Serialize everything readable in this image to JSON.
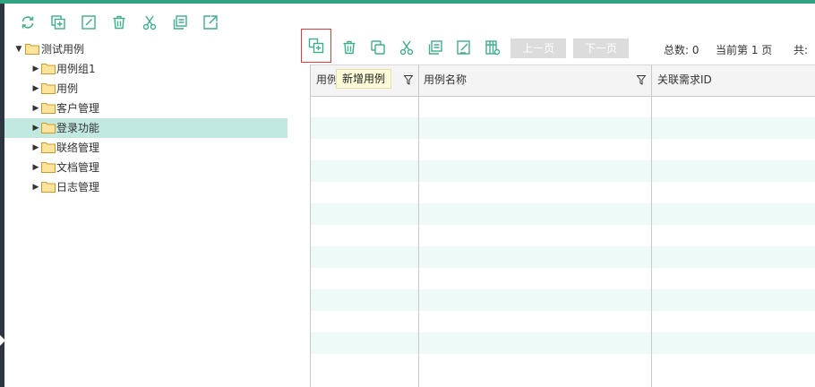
{
  "colors": {
    "accent": "#2fa382",
    "icon_green": "#3fae8e",
    "selected_row": "#c2e9df",
    "stripe": "#eefaf7",
    "folder_fill": "#fde49a",
    "folder_stroke": "#c99a2e",
    "disabled_button": "#dcdcdc",
    "tooltip_bg": "#fdfbd8"
  },
  "left_toolbar": {
    "icons": [
      "refresh-icon",
      "add-copy-icon",
      "edit-icon",
      "trash-icon",
      "scissors-icon",
      "paste-icon",
      "export-icon"
    ]
  },
  "tree": {
    "root": {
      "label": "测试用例",
      "expanded": true
    },
    "children": [
      {
        "label": "用例组1",
        "selected": false
      },
      {
        "label": "用例",
        "selected": false
      },
      {
        "label": "客户管理",
        "selected": false
      },
      {
        "label": "登录功能",
        "selected": true
      },
      {
        "label": "联络管理",
        "selected": false
      },
      {
        "label": "文档管理",
        "selected": false
      },
      {
        "label": "日志管理",
        "selected": false
      }
    ]
  },
  "right_toolbar": {
    "icons": [
      "new-case-icon",
      "trash-icon",
      "copy-icon",
      "scissors-icon",
      "paste-icon",
      "edit-icon",
      "settings-table-icon"
    ],
    "prev_page": "上一页",
    "next_page": "下一页",
    "total_text": "总数: 0",
    "current_page_text": "当前第 1 页",
    "pages_text": "共:"
  },
  "tooltip": {
    "text": "新增用例"
  },
  "grid": {
    "columns": [
      {
        "label": "用例",
        "filter": true
      },
      {
        "label": "用例名称",
        "filter": true
      },
      {
        "label": "关联需求ID",
        "filter": false
      }
    ],
    "row_count": 13
  }
}
